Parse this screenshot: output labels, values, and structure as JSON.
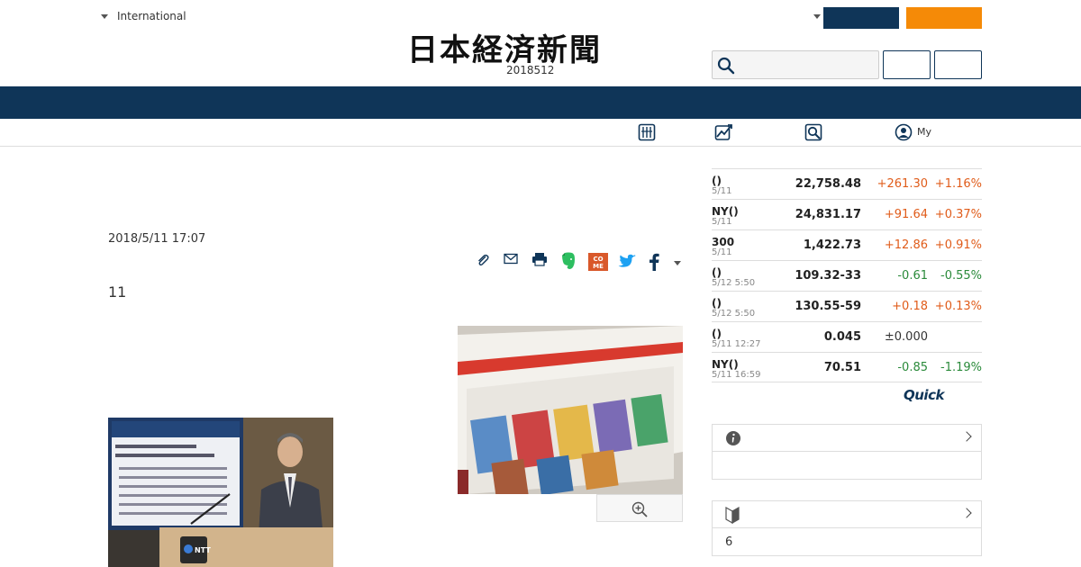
{
  "header": {
    "region_label": "International",
    "date_text": "2018512",
    "logo_text": "日本経済新聞",
    "colors": {
      "navy": "#0f3558",
      "orange": "#f58a07"
    }
  },
  "subnav": {
    "my_label": "My"
  },
  "article": {
    "date": "2018/5/11 17:07",
    "title": "11"
  },
  "market": {
    "rows": [
      {
        "name": "()",
        "date": "5/11",
        "value": "22,758.48",
        "change": "+261.30",
        "pct": "+1.16%",
        "dir": "up"
      },
      {
        "name": "NY()",
        "date": "5/11",
        "value": "24,831.17",
        "change": "+91.64",
        "pct": "+0.37%",
        "dir": "up"
      },
      {
        "name": "300",
        "date": "5/11",
        "value": "1,422.73",
        "change": "+12.86",
        "pct": "+0.91%",
        "dir": "up"
      },
      {
        "name": "()",
        "date": "5/12 5:50",
        "value": "109.32-33",
        "change": "-0.61",
        "pct": "-0.55%",
        "dir": "down"
      },
      {
        "name": "()",
        "date": "5/12 5:50",
        "value": "130.55-59",
        "change": "+0.18",
        "pct": "+0.13%",
        "dir": "up"
      },
      {
        "name": "()",
        "date": "5/11 12:27",
        "value": "0.045",
        "change": "±0.000",
        "pct": "",
        "dir": "flat"
      },
      {
        "name": "NY()",
        "date": "5/11 16:59",
        "value": "70.51",
        "change": "-0.85",
        "pct": "-1.19%",
        "dir": "down"
      }
    ],
    "quick_logo": "Quick",
    "colors": {
      "up": "#e05c1a",
      "down": "#2a8a3a",
      "flat": "#333333"
    }
  },
  "boxes": {
    "box2_body": "6"
  }
}
